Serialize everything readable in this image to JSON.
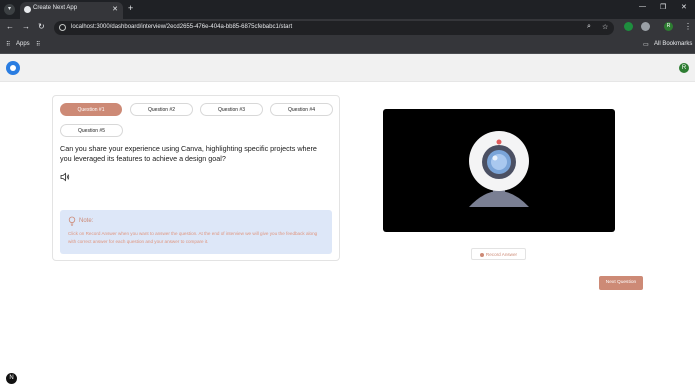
{
  "browser": {
    "tab_title": "Create Next App",
    "tab_close": "✕",
    "new_tab": "+",
    "back": "←",
    "forward": "→",
    "reload": "↻",
    "url": "localhost:3000/dashboard/interview/2ecd2655-476e-404a-bb85-6875cfebabc1/start",
    "profile_initial": "R",
    "minimize": "—",
    "restore": "❐",
    "close": "✕",
    "bookmarks": {
      "apps": "Apps",
      "all_bookmarks": "All Bookmarks"
    }
  },
  "header": {
    "user_initial": "R"
  },
  "interview": {
    "tabs": [
      "Question #1",
      "Question #2",
      "Question #3",
      "Question #4",
      "Question #5"
    ],
    "active_tab": 0,
    "question": "Can you share your experience using Canva, highlighting specific projects where you leveraged its features to achieve a design goal?",
    "note": {
      "title": "Note:",
      "text": "Click on Record Answer when you want to answer the question. At the end of interview we will give you the feedback along with correct answer for each question and your answer to compare it."
    },
    "record_button": "Record Answer",
    "next_button": "Next Question"
  },
  "footer": {
    "nextjs_badge": "N"
  },
  "colors": {
    "accent": "#cd8a76",
    "note_bg": "#dde7f8",
    "chrome_dark": "#35363a"
  }
}
